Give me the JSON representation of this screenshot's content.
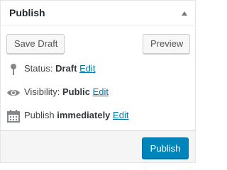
{
  "header": {
    "title": "Publish",
    "toggle_icon": "triangle-up-icon"
  },
  "actions": {
    "save_draft_label": "Save Draft",
    "preview_label": "Preview"
  },
  "status": {
    "icon": "pin-icon",
    "label": "Status:",
    "value": "Draft",
    "edit_label": "Edit"
  },
  "visibility": {
    "icon": "eye-icon",
    "label": "Visibility:",
    "value": "Public",
    "edit_label": "Edit"
  },
  "schedule": {
    "icon": "calendar-icon",
    "label": "Publish",
    "value": "immediately",
    "edit_label": "Edit"
  },
  "major": {
    "publish_label": "Publish"
  },
  "colors": {
    "link": "#0073aa",
    "primary_button": "#0085ba",
    "footer_bg": "#f5f5f5"
  }
}
